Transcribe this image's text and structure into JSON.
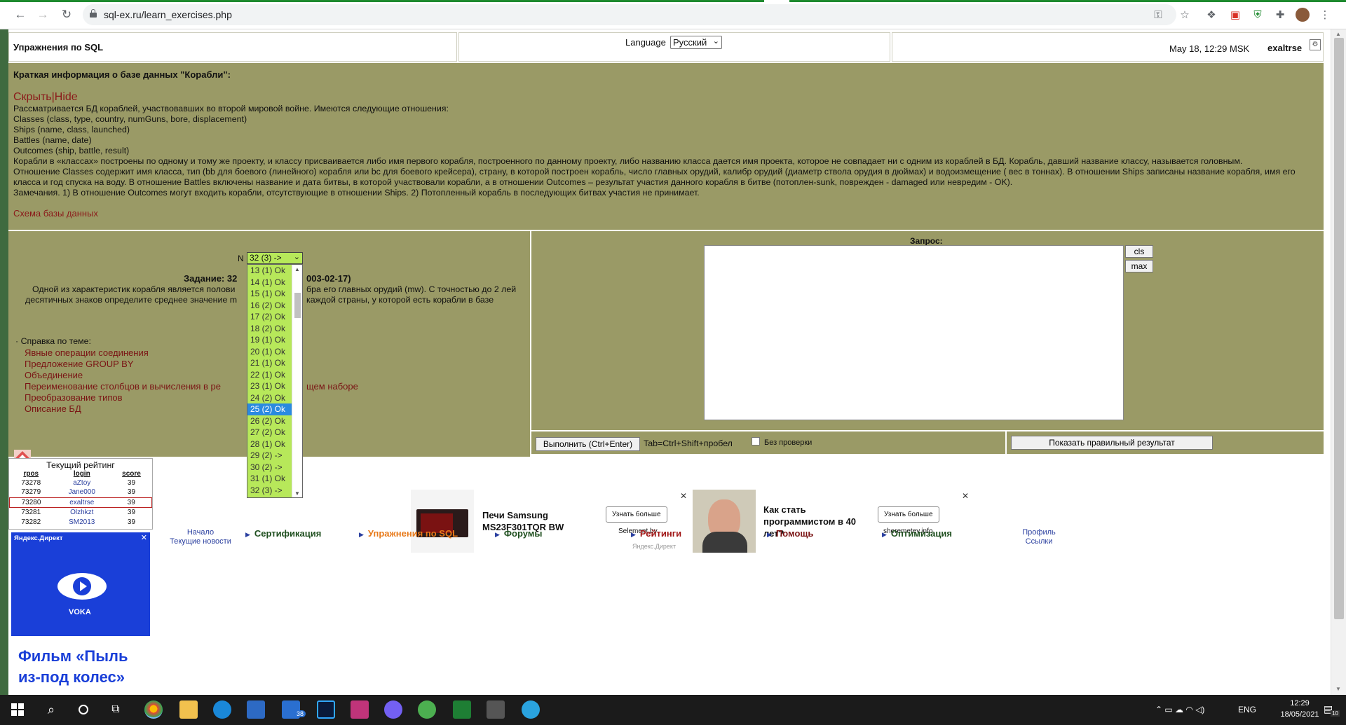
{
  "browser": {
    "url": "sql-ex.ru/learn_exercises.php"
  },
  "header": {
    "title": "Упражнения по SQL",
    "language_label": "Language",
    "language_value": "Русский",
    "date": "May 18, 12:29 MSK",
    "user": "exaltrse"
  },
  "info": {
    "title": "Краткая информация о базе данных \"Корабли\":",
    "hide_link": "Скрыть|Hide",
    "lines": [
      "Рассматривается БД кораблей, участвовавших во второй мировой войне. Имеются следующие отношения:",
      "Classes (class, type, country, numGuns, bore, displacement)",
      "Ships (name, class, launched)",
      "Battles (name, date)",
      "Outcomes (ship, battle, result)",
      "Корабли в «классах» построены по одному и тому же проекту, и классу присваивается либо имя первого корабля, построенного по данному проекту, либо названию класса дается имя проекта, которое не совпадает ни с одним из кораблей в БД. Корабль, давший название классу, называется головным.",
      "Отношение Classes содержит имя класса, тип (bb для боевого (линейного) корабля или bc для боевого крейсера), страну, в которой построен корабль, число главных орудий, калибр орудий (диаметр ствола орудия в дюймах) и водоизмещение ( вес в тоннах). В отношении Ships записаны название корабля, имя его класса и год спуска на воду. В отношение Battles включены название и дата битвы, в которой участвовали корабли, а в отношении Outcomes – результат участия данного корабля в битве (потоплен-sunk, поврежден - damaged или невредим - OK).",
      "Замечания. 1) В отношение Outcomes могут входить корабли, отсутствующие в отношении Ships. 2) Потопленный корабль в последующих битвах участия не принимает."
    ],
    "schema_link": "Схема базы данных"
  },
  "task": {
    "n_label": "N",
    "selected": "32 (3) ->",
    "title_left": "Задание: 32",
    "title_right": "003-02-17)",
    "desc_left": "Одной из характеристик корабля является полови десятичных знаков определите среднее значение m",
    "desc_right": "бра его главных орудий (mw). С точностью до 2 лей каждой страны, у которой есть корабли в базе",
    "ref_title": "· Справка по теме:",
    "refs": [
      "Явные операции соединения",
      "Предложение GROUP BY",
      "Объединение",
      "Переименование столбцов и вычисления в ре",
      "Преобразование типов",
      "Описание БД"
    ],
    "ref_tail": "щем наборе"
  },
  "dropdown": {
    "options": [
      "13 (1) Ok",
      "14 (1) Ok",
      "15 (1) Ok",
      "16 (2) Ok",
      "17 (2) Ok",
      "18 (2) Ok",
      "19 (1) Ok",
      "20 (1) Ok",
      "21 (1) Ok",
      "22 (1) Ok",
      "23 (1) Ok",
      "24 (2) Ok",
      "25 (2) Ok",
      "26 (2) Ok",
      "27 (2) Ok",
      "28 (1) Ok",
      "29 (2) ->",
      "30 (2) ->",
      "31 (1) Ok",
      "32 (3) ->"
    ],
    "selected_index": 12
  },
  "query": {
    "label": "Запрос:",
    "cls": "cls",
    "max": "max",
    "run": "Выполнить (Ctrl+Enter)",
    "tab_hint": "Tab=Ctrl+Shift+пробел",
    "no_check": "Без проверки",
    "show_result": "Показать правильный результат"
  },
  "rating": {
    "title": "Текущий рейтинг",
    "columns": [
      "rpos",
      "login",
      "score"
    ],
    "rows": [
      [
        "73278",
        "aZtoy",
        "39"
      ],
      [
        "73279",
        "Jane000",
        "39"
      ],
      [
        "73280",
        "exaltrse",
        "39"
      ],
      [
        "73281",
        "Olzhkzt",
        "39"
      ],
      [
        "73282",
        "SM2013",
        "39"
      ]
    ],
    "highlight_row": 2
  },
  "yandex_ad": {
    "label": "Яндекс.Директ",
    "brand": "VOKA",
    "text": "Фильм «Пыль из-под колес»"
  },
  "ads": [
    {
      "name": "Печи Samsung MS23F301TQR BW",
      "button": "Узнать больше",
      "site": "Selement.by",
      "source": "Яндекс.Директ"
    },
    {
      "name": "Как стать программистом в 40 лет?",
      "button": "Узнать больше",
      "site": "sheremetev.info"
    }
  ],
  "bottom_nav": {
    "left_small": [
      "Начало",
      "Текущие новости"
    ],
    "items": [
      "Сертификация",
      "Упражнения по SQL",
      "Форумы",
      "Рейтинги",
      "Помощь",
      "Оптимизация"
    ],
    "right_small": [
      "Профиль",
      "Ссылки"
    ]
  },
  "taskbar": {
    "lang": "ENG",
    "time": "12:29",
    "date": "18/05/2021",
    "mail_badge": "38",
    "notif_badge": "10"
  },
  "colors": {
    "olive": "#9a9a66",
    "link_dark_red": "#8b1a1a",
    "dropdown_green": "#b7e85a",
    "selected_blue": "#2a8ae0",
    "yandex_blue": "#1a3fd8"
  }
}
